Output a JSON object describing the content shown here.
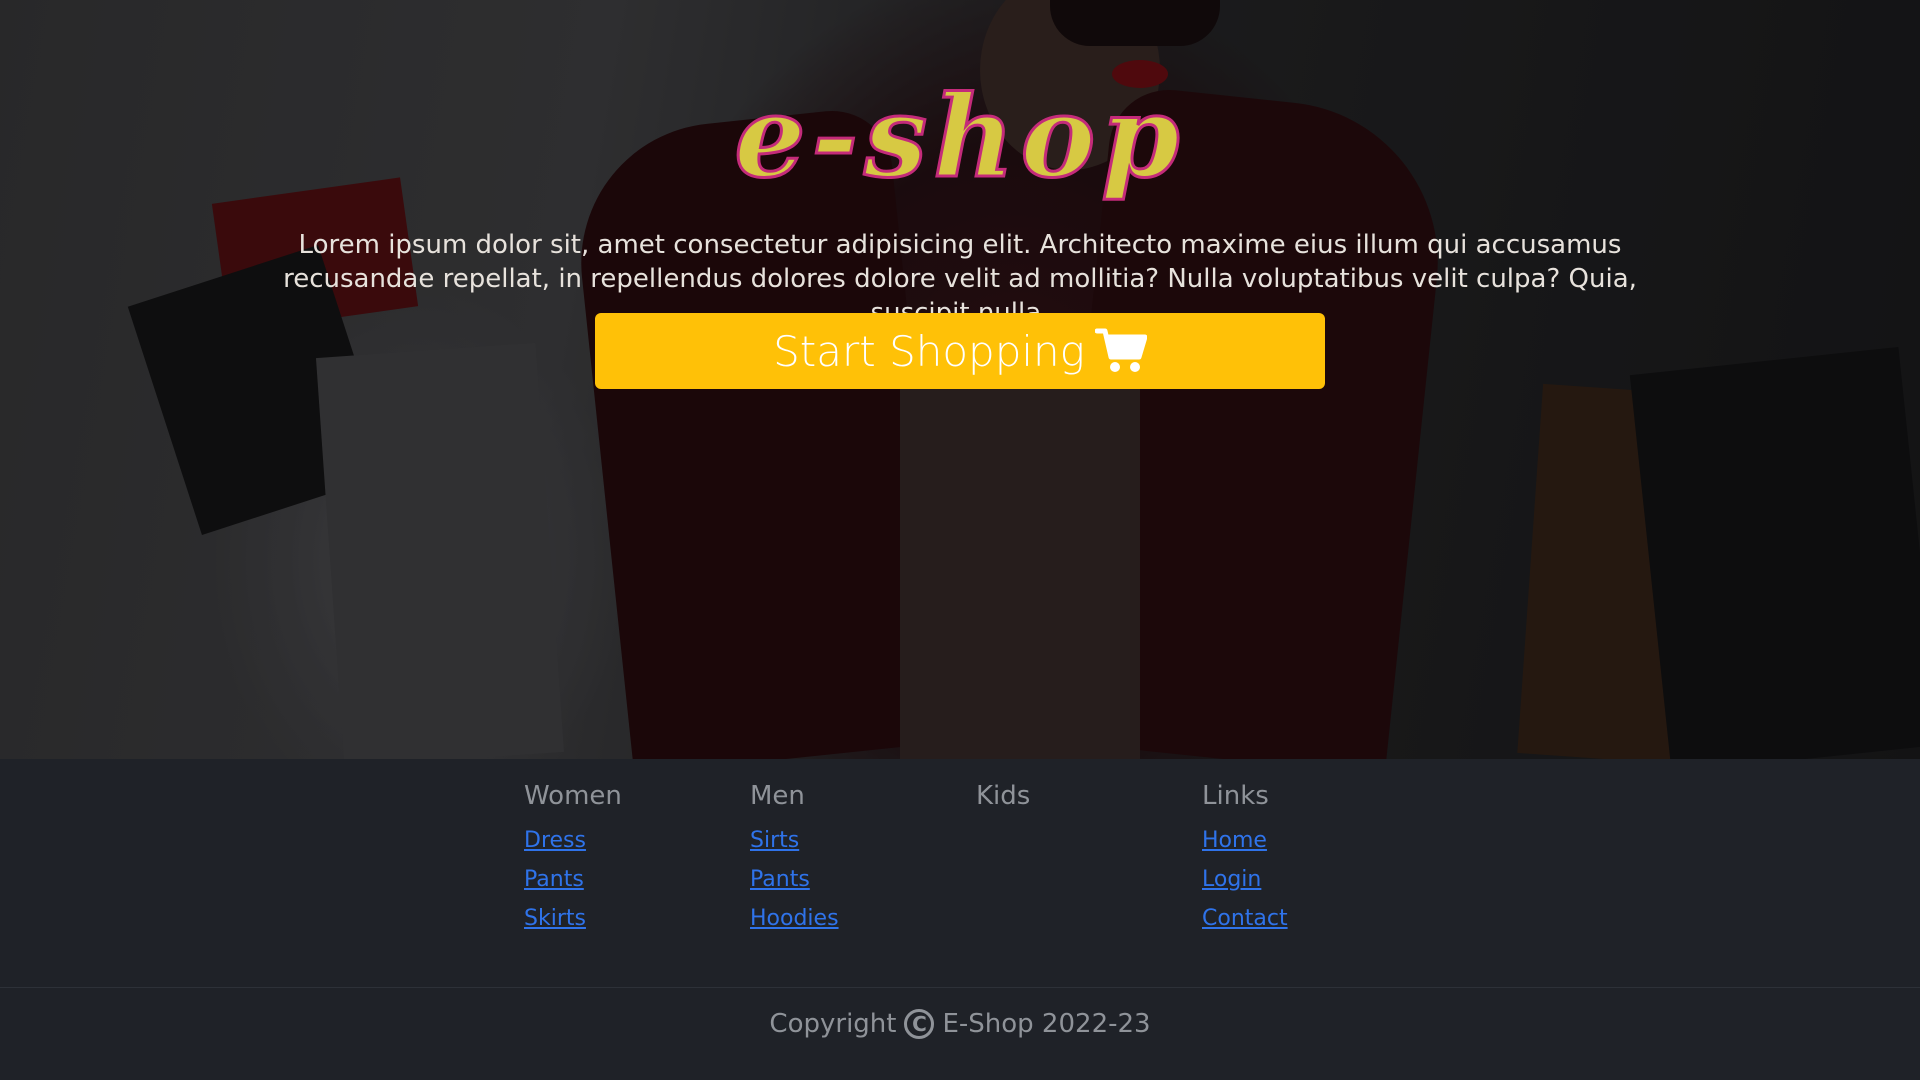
{
  "hero": {
    "logo_text": "e-shop",
    "tagline": "Lorem ipsum dolor sit, amet consectetur adipisicing elit. Architecto maxime eius illum qui accusamus recusandae repellat, in repellendus dolores dolore velit ad mollitia? Nulla voluptatibus velit culpa? Quia, suscipit nulla.",
    "cta_label": "Start Shopping",
    "cta_icon": "shopping-cart-icon",
    "cta_color": "#ffc107",
    "logo_fill_color": "#d7c943",
    "logo_stroke_color": "#c42b7a"
  },
  "footer": {
    "columns": [
      {
        "heading": "Women",
        "links": [
          "Dress",
          "Pants",
          "Skirts"
        ]
      },
      {
        "heading": "Men",
        "links": [
          "Sirts",
          "Pants",
          "Hoodies"
        ]
      },
      {
        "heading": "Kids",
        "links": []
      },
      {
        "heading": "Links",
        "links": [
          "Home",
          "Login",
          "Contact"
        ]
      }
    ],
    "copyright_prefix": "Copyright",
    "copyright_symbol": "C",
    "copyright_text": "E-Shop 2022-23",
    "link_color": "#2f73ea",
    "background_color": "#1f2228"
  }
}
